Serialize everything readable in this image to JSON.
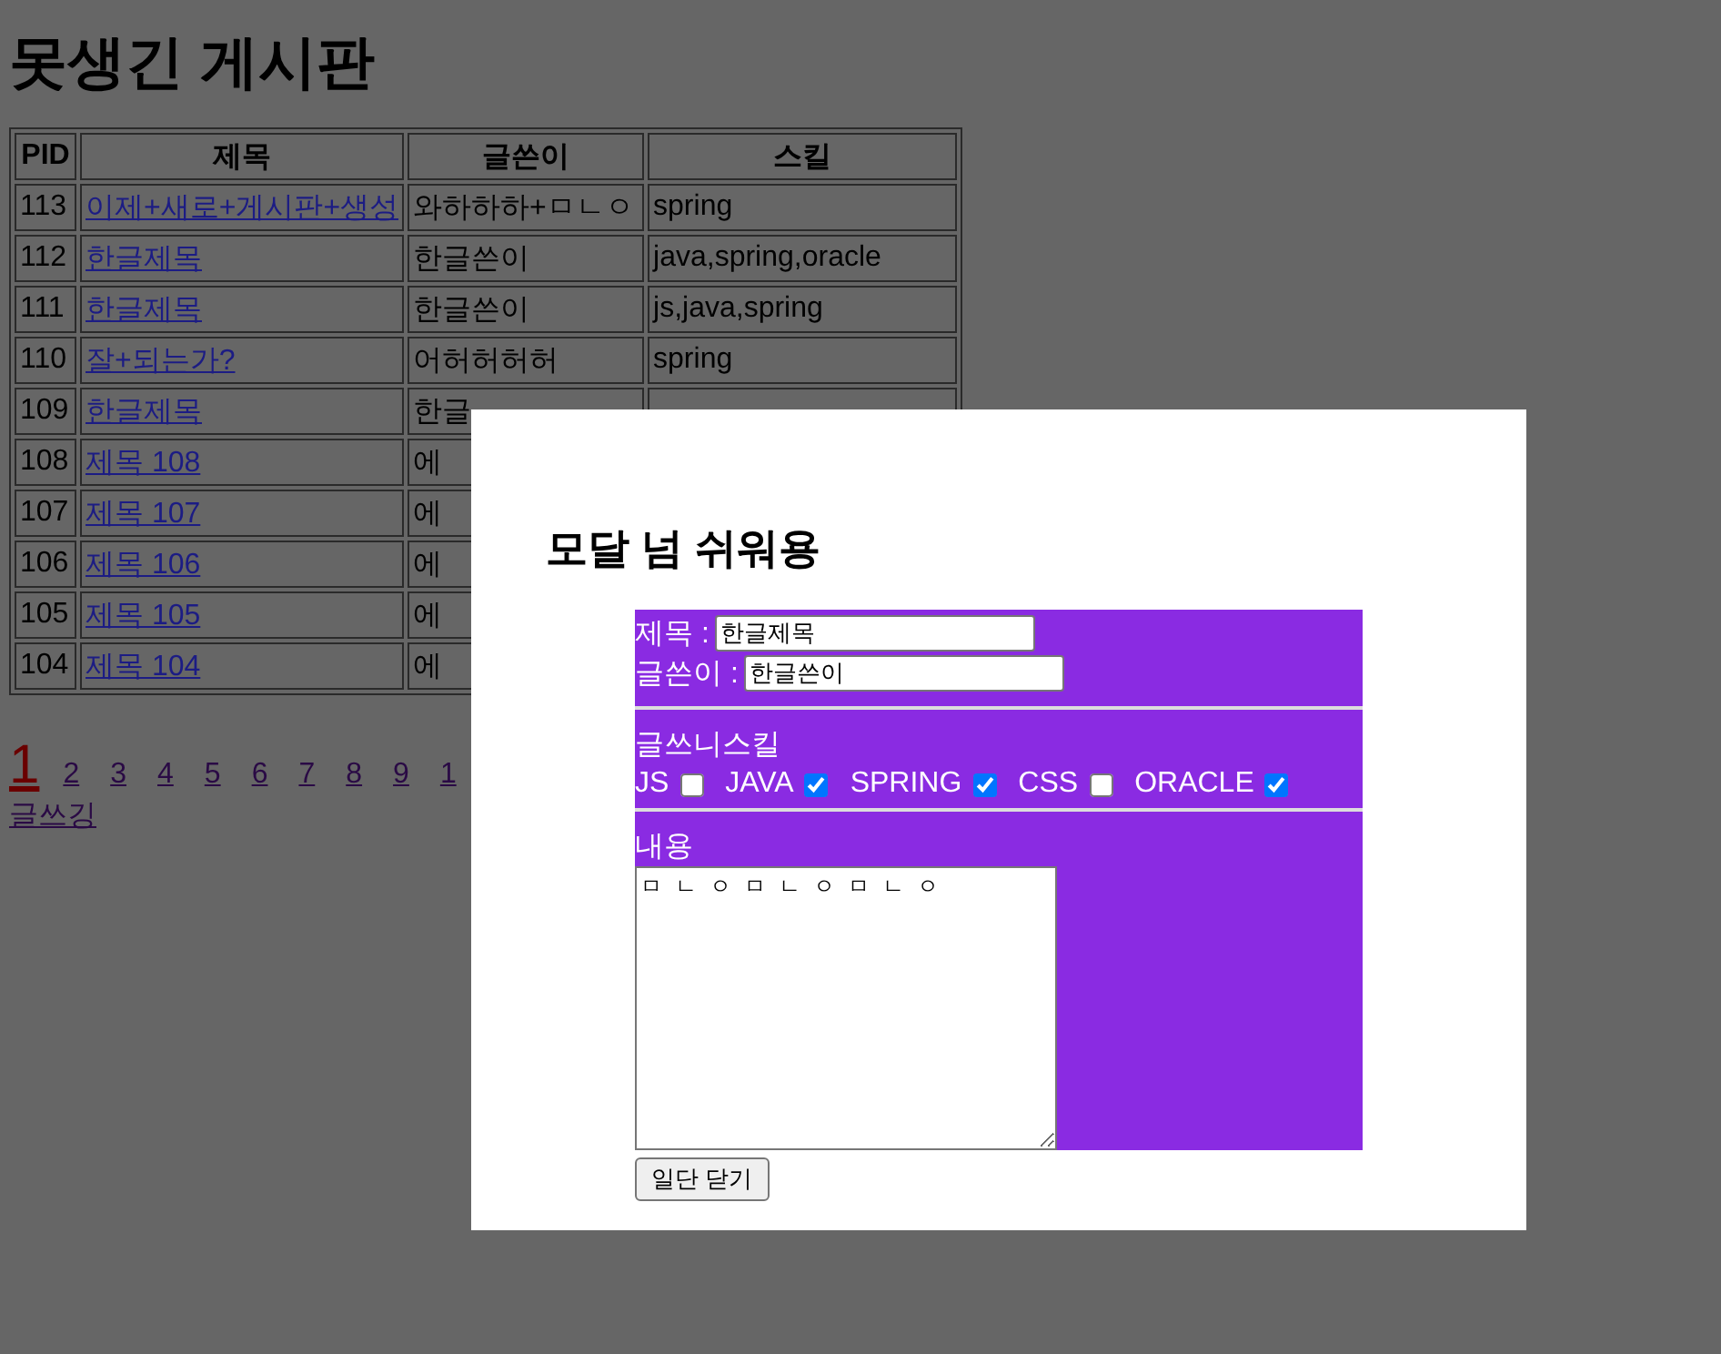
{
  "page": {
    "title": "못생긴 게시판"
  },
  "table": {
    "columns": [
      "PID",
      "제목",
      "글쓴이",
      "스킬"
    ],
    "rows": [
      {
        "pid": "113",
        "title": "이제+새로+게시판+생성",
        "writer": "와하하하+ㅁㄴㅇ",
        "skills": "spring"
      },
      {
        "pid": "112",
        "title": "한글제목",
        "writer": "한글쓴이",
        "skills": "java,spring,oracle"
      },
      {
        "pid": "111",
        "title": "한글제목",
        "writer": "한글쓴이",
        "skills": "js,java,spring"
      },
      {
        "pid": "110",
        "title": "잘+되는가?",
        "writer": "어허허허허",
        "skills": "spring"
      },
      {
        "pid": "109",
        "title": "한글제목",
        "writer": "한글"
      },
      {
        "pid": "108",
        "title": "제목 108",
        "writer": "에"
      },
      {
        "pid": "107",
        "title": "제목 107",
        "writer": "에"
      },
      {
        "pid": "106",
        "title": "제목 106",
        "writer": "에"
      },
      {
        "pid": "105",
        "title": "제목 105",
        "writer": "에"
      },
      {
        "pid": "104",
        "title": "제목 104",
        "writer": "에"
      }
    ]
  },
  "pagination": [
    {
      "label": "1",
      "selected": true
    },
    {
      "label": "2",
      "selected": false
    },
    {
      "label": "3",
      "selected": false
    },
    {
      "label": "4",
      "selected": false
    },
    {
      "label": "5",
      "selected": false
    },
    {
      "label": "6",
      "selected": false
    },
    {
      "label": "7",
      "selected": false
    },
    {
      "label": "8",
      "selected": false
    },
    {
      "label": "9",
      "selected": false
    },
    {
      "label": "1",
      "selected": false
    }
  ],
  "write_link": "글쓰깅",
  "modal": {
    "title": "모달 넘 쉬워용",
    "fields": [
      {
        "label": "제목 :",
        "value": "한글제목"
      },
      {
        "label": "글쓴이 :",
        "value": "한글쓴이"
      }
    ],
    "skills_label": "글쓰니스킬",
    "skills": [
      {
        "label": "JS",
        "checked": false
      },
      {
        "label": "JAVA",
        "checked": true
      },
      {
        "label": "SPRING",
        "checked": true
      },
      {
        "label": "CSS",
        "checked": false
      },
      {
        "label": "ORACLE",
        "checked": true
      }
    ],
    "content_label": "내용",
    "content": "ㅁㄴㅇㅁㄴㅇㅁㄴㅇ",
    "close_button": "일단 닫기"
  }
}
